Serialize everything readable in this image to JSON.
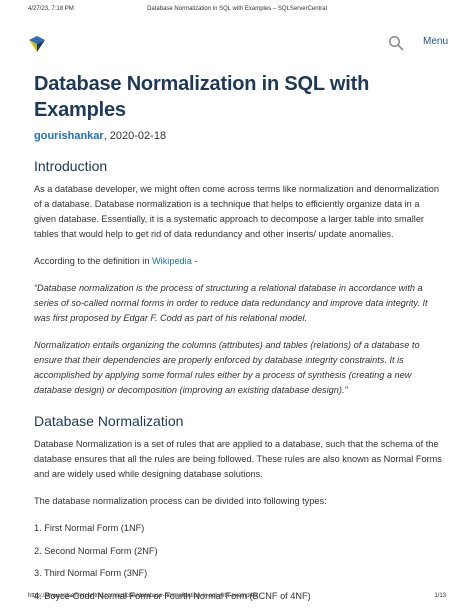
{
  "print_header": {
    "date": "4/27/23, 7:18 PM",
    "title": "Database Normalization in SQL with Examples – SQLServerCentral"
  },
  "site": {
    "logo_icon": "sqlservercentral-logo-icon",
    "search_icon": "search-icon",
    "menu_label": "Menu",
    "accent_color": "#1a4f93"
  },
  "article": {
    "title": "Database Normalization in SQL with Examples",
    "author": "gourishankar",
    "date": ", 2020-02-18",
    "intro_heading": "Introduction",
    "intro_paragraph": "As a database developer, we might often come across terms like normalization and denormalization of a database. Database normalization is a technique that helps to efficiently organize data in a given database. Essentially, it is a systematic approach to decompose a larger table into smaller tables that would help to get rid of data redundancy and other inserts/ update anomalies.",
    "definition_prefix": "According to the definition in ",
    "definition_link": "Wikipedia",
    "definition_suffix": " -",
    "quote_1": "“Database normalization is the process of structuring a relational database in accordance with a series of so-called normal forms in order to reduce data redundancy and improve data integrity. It was first proposed by Edgar F. Codd as part of his relational model.",
    "quote_2": "Normalization entails organizing the columns (attributes) and tables (relations) of a database to ensure that their dependencies are properly enforced by database integrity constraints. It is accomplished by applying some formal rules either by a process of synthesis (creating a new database design) or decomposition (improving an existing database design).”",
    "norm_heading": "Database Normalization",
    "norm_paragraph": "Database Normalization is a set of rules that are applied to a database, such that the schema of the database ensures that all the rules are being followed. These rules are also known as Normal Forms and are widely used while designing database solutions.",
    "types_intro": "The database normalization process can be divided into following types:",
    "types": [
      "1. First Normal Form (1NF)",
      "2. Second Normal Form (2NF)",
      "3. Third Normal Form (3NF)",
      "4. Boyce-Codd Normal Form or Fourth Normal Form (BCNF of 4NF)"
    ]
  },
  "print_footer": {
    "url": "https://www.sqlservercentral.com/articles/database-normalization-in-sql-with-examples",
    "page": "1/13"
  }
}
